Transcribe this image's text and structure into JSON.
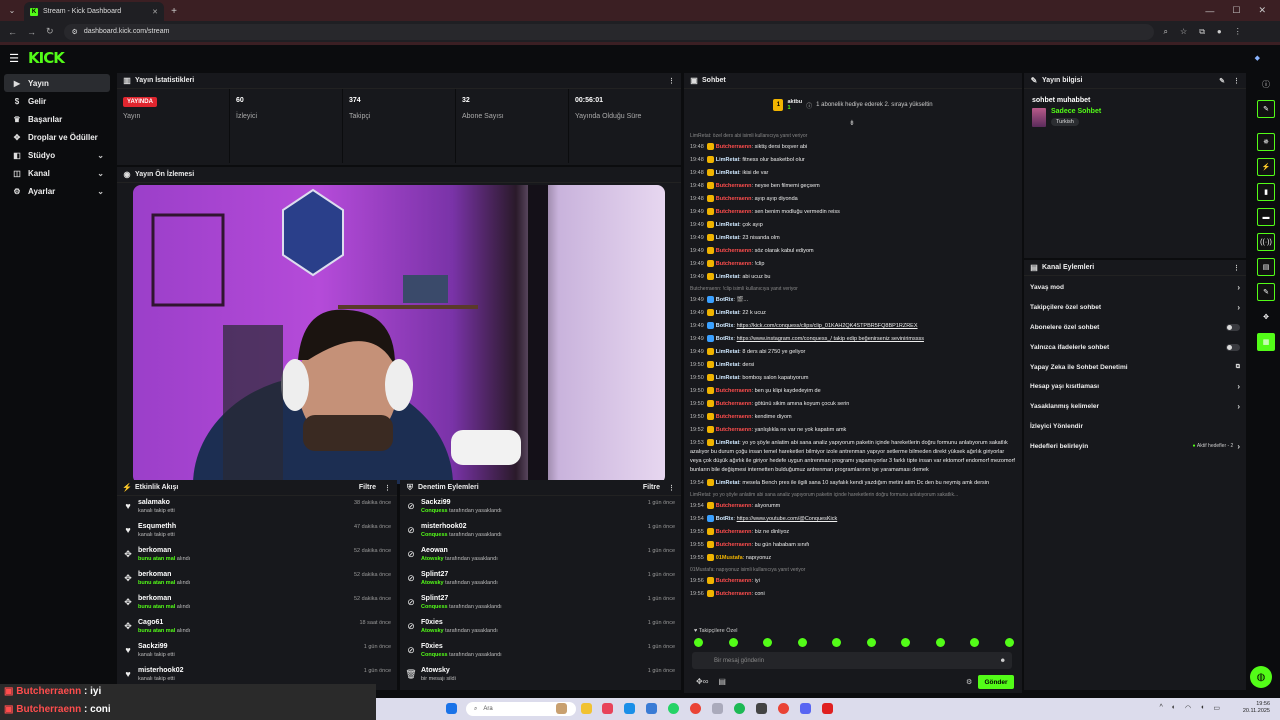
{
  "browser": {
    "tab_title": "Stream - Kick Dashboard",
    "url": "dashboard.kick.com/stream"
  },
  "header": {
    "logo": "KICK"
  },
  "sidebar": {
    "items": [
      {
        "label": "Yayın",
        "icon": "video-icon",
        "active": true
      },
      {
        "label": "Gelir",
        "icon": "dollar-icon"
      },
      {
        "label": "Başarılar",
        "icon": "trophy-icon"
      },
      {
        "label": "Droplar ve Ödüller",
        "icon": "gift-icon"
      },
      {
        "label": "Stüdyo",
        "icon": "studio-icon",
        "chev": true
      },
      {
        "label": "Kanal",
        "icon": "channel-icon",
        "chev": true
      },
      {
        "label": "Ayarlar",
        "icon": "gear-icon",
        "chev": true
      }
    ]
  },
  "stats": {
    "title": "Yayın İstatistikleri",
    "live": "YAYINDA",
    "items": [
      {
        "value": "",
        "label": "Yayın"
      },
      {
        "value": "60",
        "label": "İzleyici"
      },
      {
        "value": "374",
        "label": "Takipçi"
      },
      {
        "value": "32",
        "label": "Abone Sayısı"
      },
      {
        "value": "00:56:01",
        "label": "Yayında Olduğu Süre"
      }
    ]
  },
  "preview": {
    "title": "Yayın Ön İzlemesi"
  },
  "activity": {
    "title": "Etkinlik Akışı",
    "filter": "Filtre",
    "rows": [
      {
        "icon": "heart-icon",
        "name": "salamako",
        "sub": "kanalı takip etti",
        "time": "38 dakika önce"
      },
      {
        "icon": "heart-icon",
        "name": "Esqumethh",
        "sub": "kanalı takip etti",
        "time": "47 dakika önce"
      },
      {
        "icon": "gift-icon",
        "name": "berkoman",
        "subg": "bunu atan mal",
        "sub": " alındı",
        "time": "52 dakika önce"
      },
      {
        "icon": "gift-icon",
        "name": "berkoman",
        "subg": "bunu atan mal",
        "sub": " alındı",
        "time": "52 dakika önce"
      },
      {
        "icon": "gift-icon",
        "name": "berkoman",
        "subg": "bunu atan mal",
        "sub": " alındı",
        "time": "52 dakika önce"
      },
      {
        "icon": "gift-icon",
        "name": "Cago61",
        "subg": "bunu atan mal",
        "sub": " alındı",
        "time": "18 saat önce"
      },
      {
        "icon": "heart-icon",
        "name": "Sackzi99",
        "sub": "kanalı takip etti",
        "time": "1 gün önce"
      },
      {
        "icon": "heart-icon",
        "name": "misterhook02",
        "sub": "kanalı takip etti",
        "time": "1 gün önce"
      }
    ]
  },
  "bans": {
    "title": "Denetim Eylemleri",
    "filter": "Filtre",
    "rows": [
      {
        "icon": "ban-icon",
        "name": "Sackzi99",
        "subg": "Conquess",
        "sub": " tarafından yasaklandı",
        "time": "1 gün önce"
      },
      {
        "icon": "ban-icon",
        "name": "misterhook02",
        "subg": "Conquess",
        "sub": " tarafından yasaklandı",
        "time": "1 gün önce"
      },
      {
        "icon": "ban-icon",
        "name": "Aeowan",
        "subg": "Atowsky",
        "sub": " tarafından yasaklandı",
        "time": "1 gün önce"
      },
      {
        "icon": "ban-icon",
        "name": "Splint27",
        "subg": "Atowsky",
        "sub": " tarafından yasaklandı",
        "time": "1 gün önce"
      },
      {
        "icon": "ban-icon",
        "name": "Splint27",
        "subg": "Conquess",
        "sub": " tarafından yasaklandı",
        "time": "1 gün önce"
      },
      {
        "icon": "ban-icon",
        "name": "F0xies",
        "subg": "Atowsky",
        "sub": " tarafından yasaklandı",
        "time": "1 gün önce"
      },
      {
        "icon": "ban-icon",
        "name": "F0xies",
        "subg": "Conquess",
        "sub": " tarafından yasaklandı",
        "time": "1 gün önce"
      },
      {
        "icon": "trash-icon",
        "name": "Atowsky",
        "sub": "bir mesajı sildi",
        "time": "1 gün önce"
      }
    ]
  },
  "chat": {
    "title": "Sohbet",
    "pinned_user": "aktbu",
    "pinned_count": "1",
    "pinned_text": "1 abonelik hediye ederek 2. sıraya yükseltin",
    "follower_mode": "Takipçilere Özel",
    "input_placeholder": "Bir mesaj gönderin",
    "send": "Gönder",
    "messages": [
      {
        "reply": "LimRetat: özel ders abi isimli kullanıcıya yanıt veriyor"
      },
      {
        "time": "19:48",
        "user": "Butcherraenn",
        "color": "#ff4d4d",
        "badge": "#f1b400",
        "text": "siktiş dersi boşver abi"
      },
      {
        "time": "19:48",
        "user": "LimRetat",
        "color": "#cfe8ff",
        "badge": "#f1b400",
        "text": "fitness olur basketbol olur"
      },
      {
        "time": "19:48",
        "user": "LimRetat",
        "color": "#cfe8ff",
        "badge": "#f1b400",
        "text": "ikisi de var"
      },
      {
        "time": "19:48",
        "user": "Butcherraenn",
        "color": "#ff4d4d",
        "badge": "#f1b400",
        "text": "neyse ben filmemi geçsem"
      },
      {
        "time": "19:48",
        "user": "Butcherraenn",
        "color": "#ff4d4d",
        "badge": "#f1b400",
        "text": "ayıp ayıp diyonda"
      },
      {
        "time": "19:49",
        "user": "Butcherraenn",
        "color": "#ff4d4d",
        "badge": "#f1b400",
        "text": "sen benim modluğu vermedin reiss"
      },
      {
        "time": "19:49",
        "user": "LimRetat",
        "color": "#cfe8ff",
        "badge": "#f1b400",
        "text": "çok ayıp"
      },
      {
        "time": "19:49",
        "user": "LimRetat",
        "color": "#cfe8ff",
        "badge": "#f1b400",
        "text": "23 nisanda olm"
      },
      {
        "time": "19:49",
        "user": "Butcherraenn",
        "color": "#ff4d4d",
        "badge": "#f1b400",
        "text": "söz olarak kabul ediyom"
      },
      {
        "time": "19:49",
        "user": "Butcherraenn",
        "color": "#ff4d4d",
        "badge": "#f1b400",
        "text": "!clip"
      },
      {
        "time": "19:49",
        "user": "LimRetat",
        "color": "#cfe8ff",
        "badge": "#f1b400",
        "text": "abi ucuz bu"
      },
      {
        "reply": "Butcherraenn: !clip isimli kullanıcıya yanıt veriyor"
      },
      {
        "time": "19:49",
        "user": "BotRix",
        "color": "#cfe8ff",
        "badge": "#3aa0ff",
        "text": "🎬..."
      },
      {
        "time": "19:49",
        "user": "LimRetat",
        "color": "#cfe8ff",
        "badge": "#f1b400",
        "text": "22 k ucuz"
      },
      {
        "time": "19:49",
        "user": "BotRix",
        "color": "#cfe8ff",
        "badge": "#3aa0ff",
        "text": "https://kick.com/conquess/clips/clip_01KAH2QK4STPBR5FQ8BP1RZREX",
        "link": true
      },
      {
        "time": "19:49",
        "user": "BotRix",
        "color": "#cfe8ff",
        "badge": "#3aa0ff",
        "text": "https://www.instagram.com/conquess_/ takip edip beğenirseniz sevinirimssss",
        "link": true
      },
      {
        "time": "19:49",
        "user": "LimRetat",
        "color": "#cfe8ff",
        "badge": "#f1b400",
        "text": "8 ders abi 2750 ye geliyor"
      },
      {
        "time": "19:50",
        "user": "LimRetat",
        "color": "#cfe8ff",
        "badge": "#f1b400",
        "text": "dersi"
      },
      {
        "time": "19:50",
        "user": "LimRetat",
        "color": "#cfe8ff",
        "badge": "#f1b400",
        "text": "bomboş salon kapatıyorum"
      },
      {
        "time": "19:50",
        "user": "Butcherraenn",
        "color": "#ff4d4d",
        "badge": "#f1b400",
        "text": "ben şu klipi kaydedeyim de"
      },
      {
        "time": "19:50",
        "user": "Butcherraenn",
        "color": "#ff4d4d",
        "badge": "#f1b400",
        "text": "götünü sikim amına koyum çocuk serin"
      },
      {
        "time": "19:50",
        "user": "Butcherraenn",
        "color": "#ff4d4d",
        "badge": "#f1b400",
        "text": "kendime diyom"
      },
      {
        "time": "19:52",
        "user": "Butcherraenn",
        "color": "#ff4d4d",
        "badge": "#f1b400",
        "text": "yanlışlıkla ne var ne yok kapatım amk"
      },
      {
        "time": "19:53",
        "user": "LimRetat",
        "color": "#cfe8ff",
        "badge": "#f1b400",
        "text": "yo yo şöyle anlatim abi sana analiz yapıyorum paketin içinde hareketlerin doğru formunu anlatıyorum sakatlık azalıyor bu durum çoğu insan temel hareketleri bilmiyor izole antrenman yapıyor setlerme bilmeden direkt yüksek ağırlık giriyorlar veya çok düşük ağırlık ile giriyor hedefe uygun antrenman programı yapamıyorlar 3 farklı tipte insan var ektomorf endomorf mezomorf bunların bile değişmesi internetten bulduğumuz antrenman programlarının işe yaramaması demek"
      },
      {
        "time": "19:54",
        "user": "LimRetat",
        "color": "#cfe8ff",
        "badge": "#f1b400",
        "text": "mesela Bench pres ile ilgili sana 10 sayfalık kendi yazdığım metini atim Dc den bu neymiş amk dersin"
      },
      {
        "reply": "LimRetat: yo yo şöyle anlatim abi sana analiz yapıyorum paketin içinde hareketlerin doğru formunu anlatıyorum sakatlık..."
      },
      {
        "time": "19:54",
        "user": "Butcherraenn",
        "color": "#ff4d4d",
        "badge": "#f1b400",
        "text": "alıyorumm"
      },
      {
        "time": "19:54",
        "user": "BotRix",
        "color": "#cfe8ff",
        "badge": "#3aa0ff",
        "text": "https://www.youtube.com/@ConquesKick",
        "link": true
      },
      {
        "time": "19:55",
        "user": "Butcherraenn",
        "color": "#ff4d4d",
        "badge": "#f1b400",
        "text": "biz ne dinliyoz"
      },
      {
        "time": "19:55",
        "user": "Butcherraenn",
        "color": "#ff4d4d",
        "badge": "#f1b400",
        "text": "bu gün hababam sınıfı"
      },
      {
        "time": "19:55",
        "user": "01Mustafa",
        "color": "#f1b400",
        "badge": "#f1b400",
        "text": "napıyonuz"
      },
      {
        "reply": "01Mustafa: napıyonuz isimli kullanıcıya yanıt veriyor"
      },
      {
        "time": "19:56",
        "user": "Butcherraenn",
        "color": "#ff4d4d",
        "badge": "#f1b400",
        "text": "iyi"
      },
      {
        "time": "19:56",
        "user": "Butcherraenn",
        "color": "#ff4d4d",
        "badge": "#f1b400",
        "text": "coni"
      }
    ]
  },
  "info": {
    "title": "Yayın bilgisi",
    "stream_title": "sohbet muhabbet",
    "category": "Sadece Sohbet",
    "tag": "Turkish"
  },
  "actions": {
    "title": "Kanal Eylemleri",
    "items": [
      {
        "label": "Yavaş mod",
        "kind": "chev"
      },
      {
        "label": "Takipçilere özel sohbet",
        "kind": "chev"
      },
      {
        "label": "Abonelere özel sohbet",
        "kind": "toggle"
      },
      {
        "label": "Yalnızca ifadelerle sohbet",
        "kind": "toggle"
      },
      {
        "label": "Yapay Zeka ile Sohbet Denetimi",
        "kind": "ext"
      },
      {
        "label": "Hesap yaşı kısıtlaması",
        "kind": "chev"
      },
      {
        "label": "Yasaklanmış kelimeler",
        "kind": "chev"
      },
      {
        "label": "İzleyici Yönlendir",
        "kind": "none"
      },
      {
        "label": "Hedefleri belirleyin",
        "kind": "goal",
        "aux": "Aktif hedefler - 2"
      }
    ]
  },
  "overlay": {
    "lines": [
      {
        "user": "Butcherraenn",
        "text": " : iyi"
      },
      {
        "user": "Butcherraenn",
        "text": " : coni"
      }
    ]
  },
  "taskbar": {
    "search": "Ara",
    "time": "19:56",
    "date": "20.11.2025"
  }
}
